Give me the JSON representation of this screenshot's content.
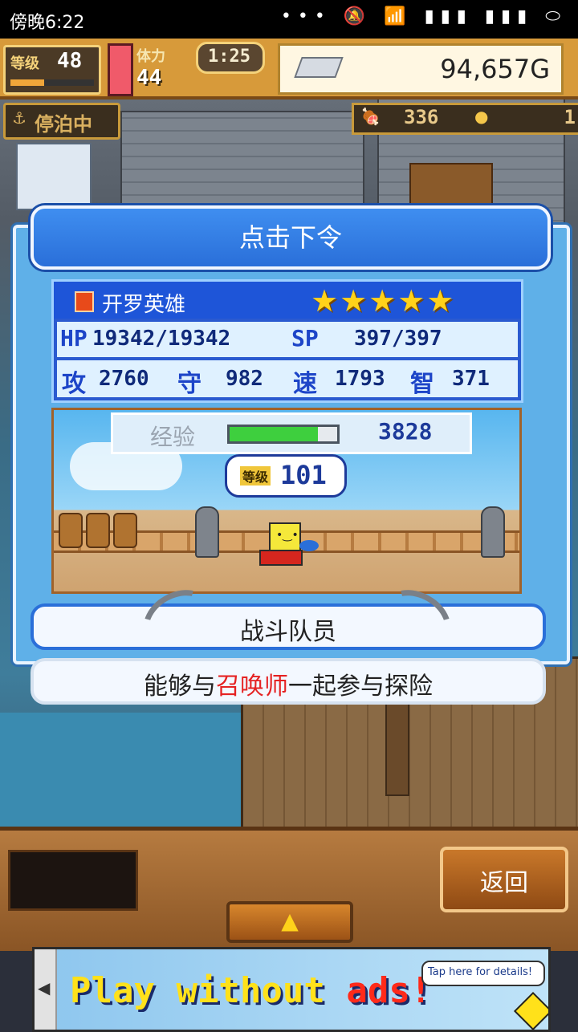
{
  "status_bar": {
    "time": "傍晚6:22",
    "icons": "••• 🔕 📶 ▮▮▮ ▮▮▮ ⬭"
  },
  "hud": {
    "level_label": "等级",
    "level": "48",
    "stamina_label": "体力",
    "stamina": "44",
    "timer": "1:25",
    "gold": "94,657G",
    "docked_label": "停泊中",
    "food": "336",
    "coins": "1"
  },
  "dialog": {
    "command_title": "点击下令",
    "hero_name": "开罗英雄",
    "stars": 5,
    "hp_label": "HP",
    "hp": "19342/19342",
    "sp_label": "SP",
    "sp": "397/397",
    "atk_label": "攻",
    "atk": "2760",
    "def_label": "守",
    "def": "982",
    "spd_label": "速",
    "spd": "1793",
    "int_label": "智",
    "int": "371",
    "exp_label": "经验",
    "exp": "3828",
    "exp_fill": 0.82,
    "hero_level_label": "等级",
    "hero_level": "101",
    "role": "战斗队员",
    "desc_before": "能够与",
    "desc_highlight": "召唤师",
    "desc_after": "一起参与探险"
  },
  "bottom": {
    "back_label": "返回",
    "up_arrow": "▲"
  },
  "ad": {
    "text1": "Play without ",
    "text2": "ads!",
    "details": "Tap here for details!",
    "left_arrow": "◀"
  },
  "colors": {
    "accent_blue": "#2a6fd9",
    "gold_bar": "#d79a3a",
    "exp_green": "#3ecf3e",
    "highlight_red": "#e52222"
  }
}
